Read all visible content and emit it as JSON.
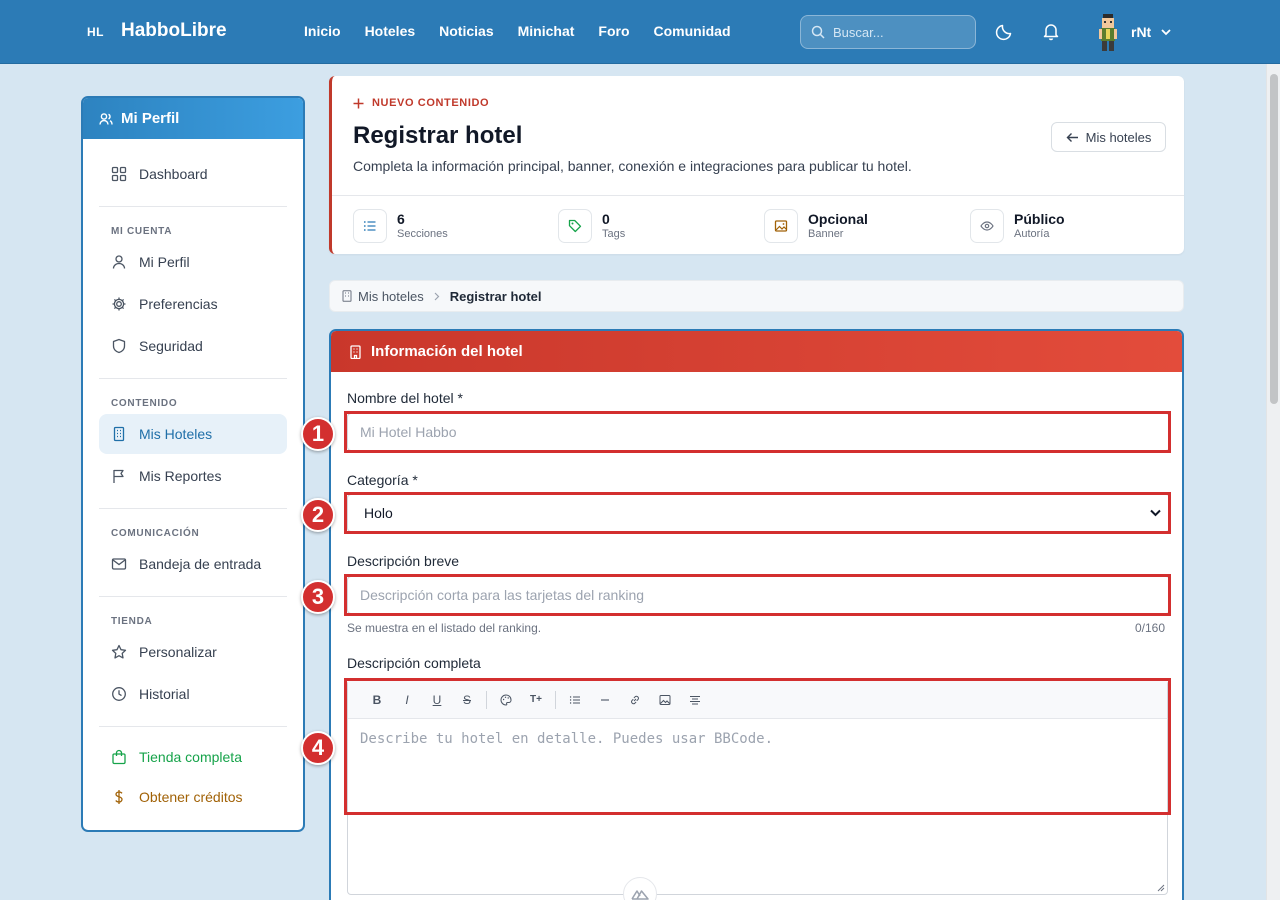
{
  "topbar": {
    "logo_mark": "HL",
    "site_name": "HabboLibre",
    "nav": [
      "Inicio",
      "Hoteles",
      "Noticias",
      "Minichat",
      "Foro",
      "Comunidad"
    ],
    "search_placeholder": "Buscar...",
    "username": "rNt"
  },
  "sidebar": {
    "title": "Mi Perfil",
    "dashboard": "Dashboard",
    "sections": {
      "account": "MI CUENTA",
      "content": "CONTENIDO",
      "communication": "COMUNICACIÓN",
      "shop": "TIENDA"
    },
    "items": {
      "profile": "Mi Perfil",
      "preferences": "Preferencias",
      "security": "Seguridad",
      "hotels": "Mis Hoteles",
      "reports": "Mis Reportes",
      "inbox": "Bandeja de entrada",
      "customize": "Personalizar",
      "history": "Historial",
      "full_shop": "Tienda completa",
      "get_credits": "Obtener créditos"
    },
    "active": "Mis Hoteles"
  },
  "header": {
    "tag": "NUEVO CONTENIDO",
    "title": "Registrar hotel",
    "description": "Completa la información principal, banner, conexión e integraciones para publicar tu hotel.",
    "back_button": "Mis hoteles",
    "stats": [
      {
        "value": "6",
        "label": "Secciones",
        "icon": "list-icon"
      },
      {
        "value": "0",
        "label": "Tags",
        "icon": "tag-icon"
      },
      {
        "value": "Opcional",
        "label": "Banner",
        "icon": "image-icon"
      },
      {
        "value": "Público",
        "label": "Autoría",
        "icon": "eye-icon"
      }
    ]
  },
  "breadcrumb": {
    "parent": "Mis hoteles",
    "current": "Registrar hotel"
  },
  "form": {
    "title": "Información del hotel",
    "name_label": "Nombre del hotel *",
    "name_placeholder": "Mi Hotel Habbo",
    "name_value": "",
    "category_label": "Categoría *",
    "category_value": "Holo",
    "short_label": "Descripción breve",
    "short_placeholder": "Descripción corta para las tarjetas del ranking",
    "short_hint": "Se muestra en el listado del ranking.",
    "short_counter": "0/160",
    "full_label": "Descripción completa",
    "full_placeholder": "Describe tu hotel en detalle. Puedes usar BBCode.",
    "toolbar": [
      "B",
      "I",
      "U",
      "S",
      "palette-icon",
      "T+",
      "list-icon",
      "hr-icon",
      "link-icon",
      "image-icon",
      "align-icon"
    ]
  },
  "annotations": [
    "1",
    "2",
    "3",
    "4"
  ],
  "colors": {
    "topbar": "#2c7bb6",
    "page_bg": "#d6e6f2",
    "accent_red": "#c0392b",
    "annotation": "#d32f2f",
    "active_item": "#1f6fa8"
  }
}
